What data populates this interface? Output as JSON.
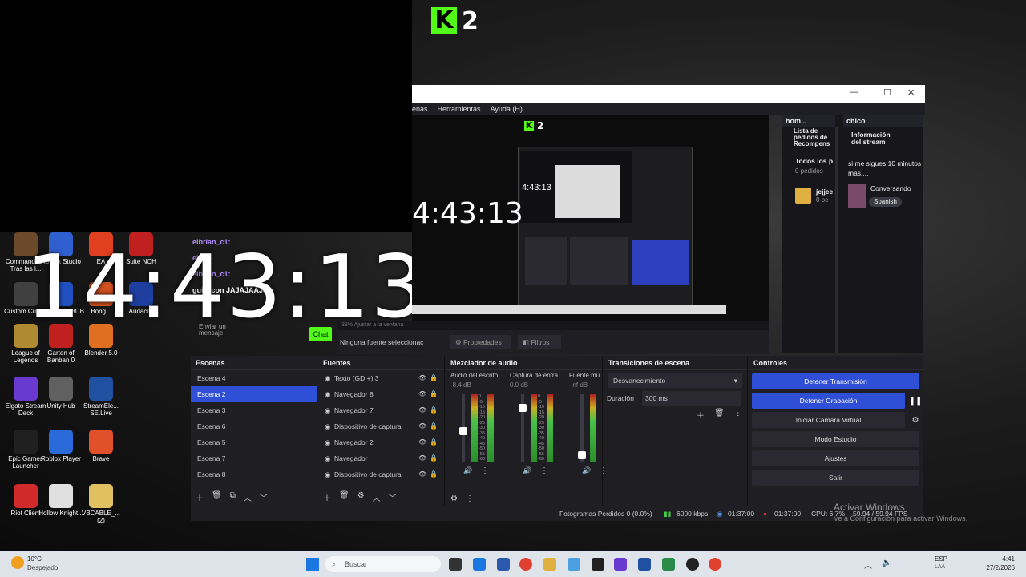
{
  "top_logo": {
    "letter": "K",
    "number": "2"
  },
  "big_clock": "14:43:13",
  "mid_clock": "4:43:13",
  "tiny_clock": "4:43:13",
  "desktop_icons": [
    {
      "label": "Commandos - Tras las l...",
      "color": "#6a4a2a"
    },
    {
      "label": "Roblox Studio",
      "color": "#3060d0"
    },
    {
      "label": "EA",
      "color": "#e04020"
    },
    {
      "label": "Suite NCH",
      "color": "#c02020"
    },
    {
      "label": "Custom Cursor",
      "color": "#404040"
    },
    {
      "label": "Logitech G HUB",
      "color": "#2050c0"
    },
    {
      "label": "Bong...",
      "color": "#d05020"
    },
    {
      "label": "Audacity",
      "color": "#1e3ea0"
    },
    {
      "label": "League of Legends",
      "color": "#b08a30"
    },
    {
      "label": "Garten of Banban 0",
      "color": "#c02020"
    },
    {
      "label": "Blender 5.0",
      "color": "#e07020"
    },
    {
      "label": "Elgato Stream Deck",
      "color": "#6a3ad0"
    },
    {
      "label": "Unity Hub",
      "color": "#606060"
    },
    {
      "label": "StreamEle... SE.Live",
      "color": "#2050a0"
    },
    {
      "label": "Epic Games Launcher",
      "color": "#202020"
    },
    {
      "label": "Roblox Player",
      "color": "#2a6ad8"
    },
    {
      "label": "Brave",
      "color": "#e0502a"
    },
    {
      "label": "Riot Client",
      "color": "#d02a2a"
    },
    {
      "label": "Hollow Knight...",
      "color": "#e0e0e0"
    },
    {
      "label": "VBCABLE_... (2)",
      "color": "#e0c060"
    }
  ],
  "chat": {
    "lines": [
      "elbrian_c1:",
      "elbri...",
      "elbrian_c1:",
      "guillecon JAJAJAAJJ"
    ],
    "input_placeholder": "Enviar un mensaje",
    "chat_button": "Chat"
  },
  "obs": {
    "menu": [
      "enas",
      "Herramientas",
      "Ayuda (H)"
    ],
    "zoom_label": "33%  Ajustar a la ventana",
    "no_source": "Ninguna fuente seleccionac",
    "properties_btn": "Propiedades",
    "filters_btn": "Filtros",
    "docks": {
      "left_tab": "hom...",
      "right_tab": "chico",
      "rewards_title": "Lista de pedidos de Recompens",
      "all_label": "Todos los p",
      "orders_count": "0 pedidos",
      "reward_user": "jejjee",
      "reward_sub": "0 pe",
      "stream_info_title": "Información del stream",
      "stream_title": "si me sigues 10 minutos mas,...",
      "category": "Conversando",
      "language": "Spanish"
    },
    "scenes": {
      "title": "Escenas",
      "items": [
        "Escena 4",
        "Escena 2",
        "Escena 3",
        "Escena 6",
        "Escena 5",
        "Escena 7",
        "Escena 8"
      ],
      "selected_index": 1
    },
    "sources": {
      "title": "Fuentes",
      "items": [
        "Texto (GDI+) 3",
        "Navegador 8",
        "Navegador 7",
        "Dispositivo de captura",
        "Navegador 2",
        "Navegador",
        "Dispositivo de captura"
      ]
    },
    "mixer": {
      "title": "Mezclador de audio",
      "channels": [
        {
          "name": "Audio del escrito",
          "db": "-8.4 dB",
          "level": 0.45
        },
        {
          "name": "Captura de entra",
          "db": "0.0 dB",
          "level": 0.8
        },
        {
          "name": "Fuente mu",
          "db": "-inf dB",
          "level": 0.1
        }
      ],
      "scale": [
        "0",
        "-5",
        "-10",
        "-15",
        "-20",
        "-25",
        "-30",
        "-35",
        "-40",
        "-45",
        "-50",
        "-55",
        "-60"
      ]
    },
    "transitions": {
      "title": "Transiciones de escena",
      "selected": "Desvanecimiento",
      "duration_label": "Duración",
      "duration_value": "300 ms"
    },
    "controls": {
      "title": "Controles",
      "stop_stream": "Detener Transmisión",
      "stop_record": "Detener Grabación",
      "virtual_cam": "Iniciar Cámara Virtual",
      "studio_mode": "Modo Estudio",
      "settings": "Ajustes",
      "exit": "Salir"
    },
    "status": {
      "dropped": "Fotogramas Perdidos 0 (0.0%)",
      "bitrate": "6000 kbps",
      "stream_time": "01:37:00",
      "rec_time": "01:37:00",
      "cpu": "CPU: 6.7%",
      "fps": "59.94 / 59.94 FPS"
    }
  },
  "watermark": {
    "line1": "Activar Windows",
    "line2": "Ve a Configuración para activar Windows."
  },
  "taskbar": {
    "weather_temp": "10°C",
    "weather_desc": "Despejado",
    "search_placeholder": "Buscar",
    "lang": "ESP",
    "lang_sub": "LAA",
    "time": "4:41",
    "date": "27/2/2026"
  }
}
